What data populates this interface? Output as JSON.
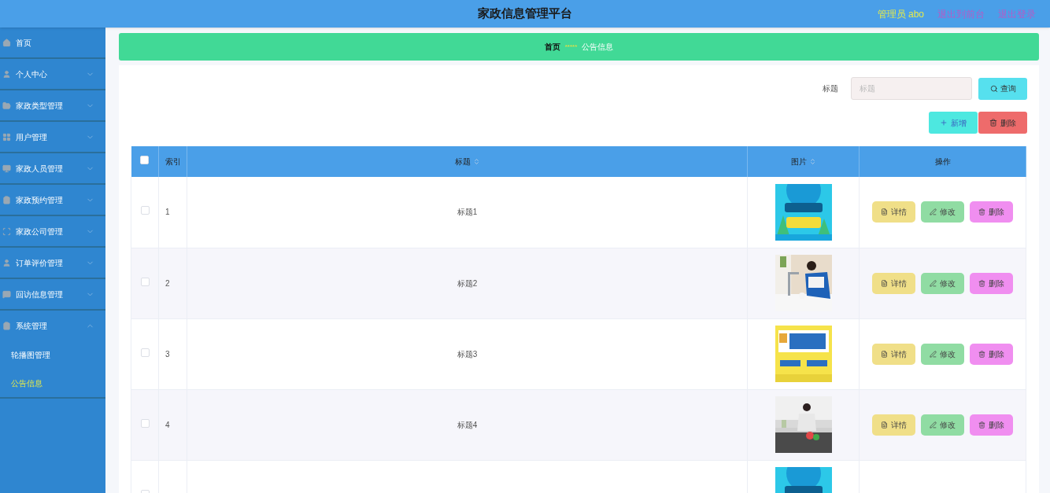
{
  "header": {
    "title": "家政信息管理平台",
    "user": "管理员 abo",
    "links": [
      "退出到前台",
      "退出登录"
    ]
  },
  "sidebar": {
    "items": [
      {
        "label": "首页",
        "kind": "link"
      },
      {
        "label": "个人中心",
        "kind": "group",
        "expanded": false
      },
      {
        "label": "家政类型管理",
        "kind": "group",
        "expanded": false
      },
      {
        "label": "用户管理",
        "kind": "group",
        "expanded": false
      },
      {
        "label": "家政人员管理",
        "kind": "group",
        "expanded": false
      },
      {
        "label": "家政预约管理",
        "kind": "group",
        "expanded": false
      },
      {
        "label": "家政公司管理",
        "kind": "group",
        "expanded": false
      },
      {
        "label": "订单评价管理",
        "kind": "group",
        "expanded": false
      },
      {
        "label": "回访信息管理",
        "kind": "group",
        "expanded": false
      },
      {
        "label": "系统管理",
        "kind": "group",
        "expanded": true,
        "children": [
          {
            "label": "轮播图管理",
            "selected": false
          },
          {
            "label": "公告信息",
            "selected": true
          }
        ]
      }
    ]
  },
  "breadcrumb": {
    "home": "首页",
    "separator": "*****",
    "current": "公告信息"
  },
  "search": {
    "label": "标题",
    "placeholder": "标题",
    "button": "查询"
  },
  "actions": {
    "add": "新增",
    "delete": "删除"
  },
  "table": {
    "select_all": {
      "checked": false
    },
    "columns": [
      {
        "label": "索引",
        "sortable": false
      },
      {
        "label": "标题",
        "sortable": true
      },
      {
        "label": "图片",
        "sortable": true
      },
      {
        "label": "操作",
        "sortable": false
      }
    ],
    "rows": [
      {
        "checked": false,
        "index": "1",
        "title": "标题1",
        "picture": {
          "kind": "picture"
        },
        "buttons": [
          "详情",
          "修改",
          "删除"
        ]
      },
      {
        "checked": false,
        "index": "2",
        "title": "标题2",
        "picture": {
          "kind": "picture"
        },
        "buttons": [
          "详情",
          "修改",
          "删除"
        ]
      },
      {
        "checked": false,
        "index": "3",
        "title": "标题3",
        "picture": {
          "kind": "picture"
        },
        "buttons": [
          "详情",
          "修改",
          "删除"
        ]
      },
      {
        "checked": false,
        "index": "4",
        "title": "标题4",
        "picture": {
          "kind": "picture"
        },
        "buttons": [
          "详情",
          "修改",
          "删除"
        ]
      },
      {
        "checked": false,
        "picture": {
          "kind": "picture"
        }
      }
    ]
  }
}
